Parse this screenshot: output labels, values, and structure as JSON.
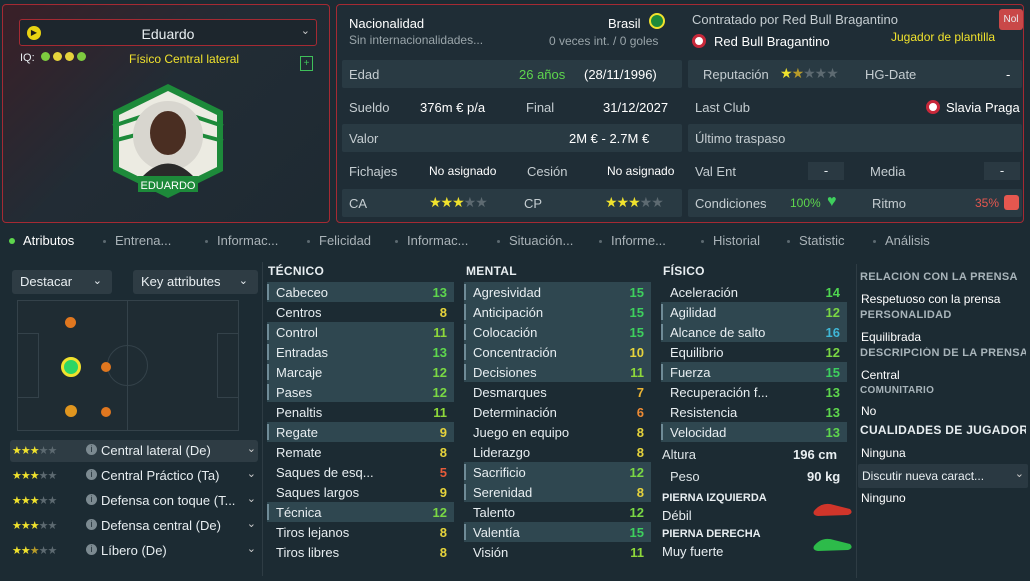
{
  "player": {
    "name": "Eduardo",
    "iq_label": "IQ:",
    "role": "Físico  Central lateral",
    "badge_name": "EDUARDO"
  },
  "info": {
    "nationality_label": "Nacionalidad",
    "nationality": "Brasil",
    "intl_note": "Sin internacionalidades...",
    "intl_stats": "0 veces int. / 0 goles",
    "age_label": "Edad",
    "age": "26 años",
    "dob": "(28/11/1996)",
    "wage_label": "Sueldo",
    "wage": "376m € p/a",
    "end_label": "Final",
    "end": "31/12/2027",
    "value_label": "Valor",
    "value": "2M € - 2.7M €",
    "signings_label": "Fichajes",
    "signings": "No asignado",
    "loan_label": "Cesión",
    "loan": "No asignado",
    "ca_label": "CA",
    "cp_label": "CP",
    "ca_stars": 3,
    "cp_stars": 3
  },
  "contract": {
    "title": "Contratado por Red Bull Bragantino",
    "club": "Red Bull Bragantino",
    "status": "Jugador de plantilla",
    "nol": "Nol",
    "rep_label": "Reputación",
    "rep_stars": 1.5,
    "hg_label": "HG-Date",
    "hg": "-",
    "last_club_label": "Last Club",
    "last_club": "Slavia Praga",
    "transfer_label": "Último traspaso",
    "valent_label": "Val Ent",
    "valent": "-",
    "media_label": "Media",
    "media": "-",
    "cond_label": "Condiciones",
    "cond": "100%",
    "ritmo_label": "Ritmo",
    "ritmo": "35%"
  },
  "tabs": [
    "Atributos",
    "Entrena...",
    "Informac...",
    "Felicidad",
    "Informac...",
    "Situación...",
    "Informe...",
    "Historial",
    "Statistic",
    "Análisis"
  ],
  "controls": {
    "highlight": "Destacar",
    "key": "Key attributes"
  },
  "positions": [
    {
      "stars": "★★★",
      "label": "Central lateral (De)"
    },
    {
      "stars": "★★★",
      "label": "Central Práctico (Ta)"
    },
    {
      "stars": "★★★",
      "label": "Defensa con toque (T..."
    },
    {
      "stars": "★★★",
      "label": "Defensa central (De)"
    },
    {
      "stars": "★★½",
      "label": "Líbero (De)"
    }
  ],
  "columns": {
    "tec": "TÉCNICO",
    "men": "MENTAL",
    "fis": "FÍSICO"
  },
  "tecnico": [
    {
      "n": "Cabeceo",
      "v": 13,
      "h": true,
      "c": "#5ed64d"
    },
    {
      "n": "Centros",
      "v": 8,
      "h": false,
      "c": "#e6d33c"
    },
    {
      "n": "Control",
      "v": 11,
      "h": true,
      "c": "#8ed83a"
    },
    {
      "n": "Entradas",
      "v": 13,
      "h": true,
      "c": "#5ed64d"
    },
    {
      "n": "Marcaje",
      "v": 12,
      "h": true,
      "c": "#7ad744"
    },
    {
      "n": "Pases",
      "v": 12,
      "h": true,
      "c": "#7ad744"
    },
    {
      "n": "Penaltis",
      "v": 11,
      "h": false,
      "c": "#8ed83a"
    },
    {
      "n": "Regate",
      "v": 9,
      "h": true,
      "c": "#e6d33c"
    },
    {
      "n": "Remate",
      "v": 8,
      "h": false,
      "c": "#e6d33c"
    },
    {
      "n": "Saques de esq...",
      "v": 5,
      "h": false,
      "c": "#e55a3a"
    },
    {
      "n": "Saques largos",
      "v": 9,
      "h": false,
      "c": "#e6d33c"
    },
    {
      "n": "Técnica",
      "v": 12,
      "h": true,
      "c": "#7ad744"
    },
    {
      "n": "Tiros lejanos",
      "v": 8,
      "h": false,
      "c": "#e6d33c"
    },
    {
      "n": "Tiros libres",
      "v": 8,
      "h": false,
      "c": "#e6d33c"
    }
  ],
  "mental": [
    {
      "n": "Agresividad",
      "v": 15,
      "h": true,
      "c": "#3ecf5d"
    },
    {
      "n": "Anticipación",
      "v": 15,
      "h": true,
      "c": "#3ecf5d"
    },
    {
      "n": "Colocación",
      "v": 15,
      "h": true,
      "c": "#3ecf5d"
    },
    {
      "n": "Concentración",
      "v": 10,
      "h": true,
      "c": "#e6d33c"
    },
    {
      "n": "Decisiones",
      "v": 11,
      "h": true,
      "c": "#8ed83a"
    },
    {
      "n": "Desmarques",
      "v": 7,
      "h": false,
      "c": "#ecb534"
    },
    {
      "n": "Determinación",
      "v": 6,
      "h": false,
      "c": "#ec8a34"
    },
    {
      "n": "Juego en equipo",
      "v": 8,
      "h": false,
      "c": "#e6d33c"
    },
    {
      "n": "Liderazgo",
      "v": 8,
      "h": false,
      "c": "#e6d33c"
    },
    {
      "n": "Sacrificio",
      "v": 12,
      "h": true,
      "c": "#7ad744"
    },
    {
      "n": "Serenidad",
      "v": 8,
      "h": true,
      "c": "#e6d33c"
    },
    {
      "n": "Talento",
      "v": 12,
      "h": false,
      "c": "#7ad744"
    },
    {
      "n": "Valentía",
      "v": 15,
      "h": true,
      "c": "#3ecf5d"
    },
    {
      "n": "Visión",
      "v": 11,
      "h": false,
      "c": "#8ed83a"
    }
  ],
  "fisico": [
    {
      "n": "Aceleración",
      "v": 14,
      "h": false,
      "c": "#4fd450"
    },
    {
      "n": "Agilidad",
      "v": 12,
      "h": true,
      "c": "#7ad744"
    },
    {
      "n": "Alcance de salto",
      "v": 16,
      "h": true,
      "c": "#3fb6d6"
    },
    {
      "n": "Equilibrio",
      "v": 12,
      "h": false,
      "c": "#7ad744"
    },
    {
      "n": "Fuerza",
      "v": 15,
      "h": true,
      "c": "#3ecf5d"
    },
    {
      "n": "Recuperación f...",
      "v": 13,
      "h": false,
      "c": "#5ed64d"
    },
    {
      "n": "Resistencia",
      "v": 13,
      "h": false,
      "c": "#5ed64d"
    },
    {
      "n": "Velocidad",
      "v": 13,
      "h": true,
      "c": "#5ed64d"
    }
  ],
  "body": {
    "height_label": "Altura",
    "height": "196 cm",
    "weight_label": "Peso",
    "weight": "90 kg",
    "left_foot_label": "PIERNA IZQUIERDA",
    "left_foot": "Débil",
    "right_foot_label": "PIERNA DERECHA",
    "right_foot": "Muy fuerte"
  },
  "side": {
    "press_rel_label": "RELACIÓN CON LA PRENSA",
    "press_rel": "Respetuoso con la prensa",
    "personality_label": "PERSONALIDAD",
    "personality": "Equilibrada",
    "press_desc_label": "DESCRIPCIÓN DE LA PRENSA",
    "press_desc": "Central",
    "community_label": "COMUNITARIO",
    "community": "No",
    "qualities_label": "CUALIDADES DE JUGADOR",
    "qualities": "Ninguna",
    "discuss": "Discutir nueva caract...",
    "discuss_value": "Ninguno"
  },
  "colors": {
    "accent_red": "#a52a33",
    "yellow": "#f0e22d",
    "green": "#5ed64d"
  }
}
